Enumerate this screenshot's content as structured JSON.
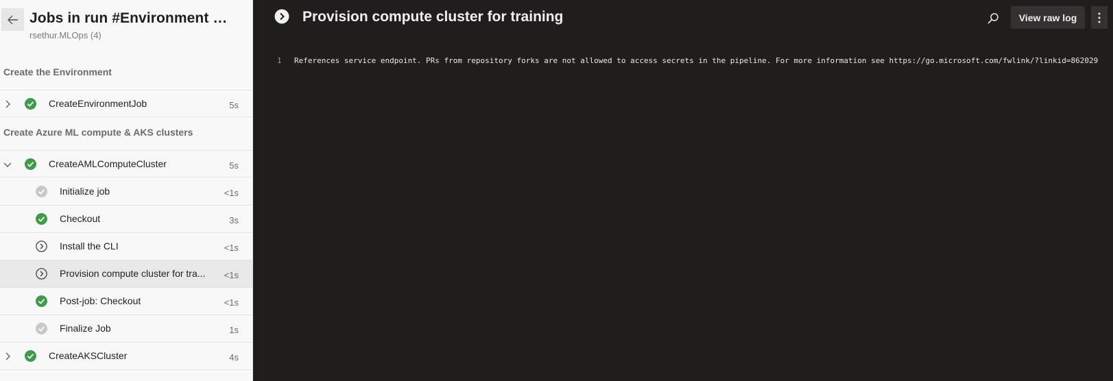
{
  "header": {
    "title": "Jobs in run #Environment Cre...",
    "subtitle": "rsethur.MLOps (4)"
  },
  "stages": [
    {
      "name": "Create the Environment"
    },
    {
      "name": "Create Azure ML compute & AKS clusters"
    }
  ],
  "jobs": {
    "create_env": {
      "label": "CreateEnvironmentJob",
      "duration": "5s",
      "status": "succeeded"
    },
    "create_aml": {
      "label": "CreateAMLComputeCluster",
      "duration": "5s",
      "status": "succeeded"
    },
    "create_aks": {
      "label": "CreateAKSCluster",
      "duration": "4s",
      "status": "succeeded"
    }
  },
  "steps": [
    {
      "label": "Initialize job",
      "duration": "<1s",
      "status": "skipped"
    },
    {
      "label": "Checkout",
      "duration": "3s",
      "status": "succeeded"
    },
    {
      "label": "Install the CLI",
      "duration": "<1s",
      "status": "pending"
    },
    {
      "label": "Provision compute cluster for tra...",
      "duration": "<1s",
      "status": "pending",
      "selected": true
    },
    {
      "label": "Post-job: Checkout",
      "duration": "<1s",
      "status": "succeeded"
    },
    {
      "label": "Finalize Job",
      "duration": "1s",
      "status": "skipped"
    }
  ],
  "detail": {
    "title": "Provision compute cluster for training",
    "raw_log_label": "View raw log",
    "log": [
      {
        "num": "1",
        "text": "References service endpoint. PRs from repository forks are not allowed to access secrets in the pipeline. For more information see https://go.microsoft.com/fwlink/?linkid=862029"
      }
    ]
  },
  "colors": {
    "success": "#3f9b4a",
    "skipped": "#c8c8c8",
    "left_bg": "#f8f8f8",
    "right_bg": "#1f1e1d"
  }
}
